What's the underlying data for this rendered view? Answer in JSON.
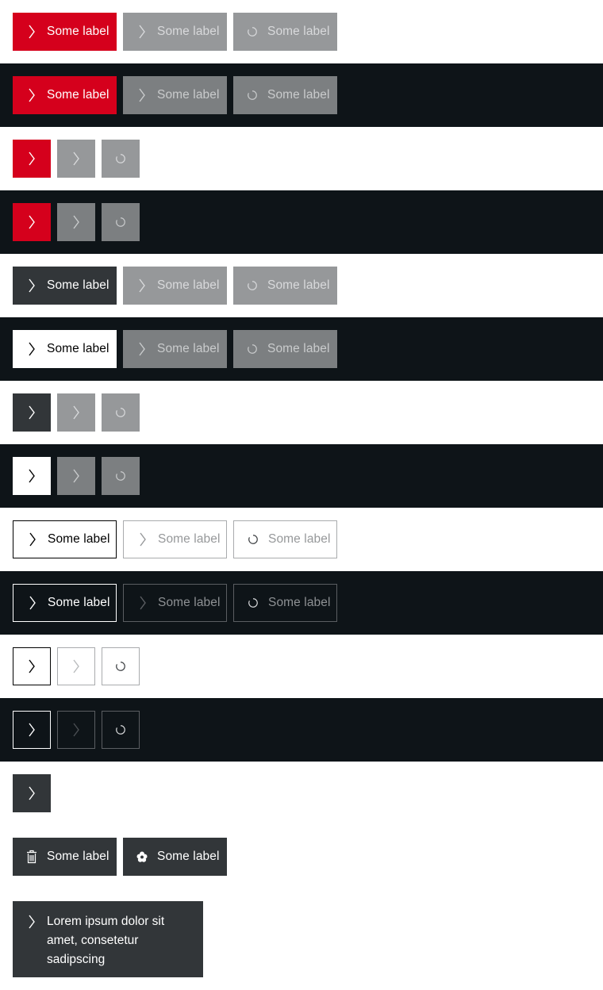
{
  "button_label": "Some label",
  "multiline_label": "Lorem ipsum dolor sit amet, consetetur sadipscing",
  "icons": {
    "arrow": "arrow-right-icon",
    "loading": "spinner-icon",
    "delete": "trash-icon",
    "custom": "flower-icon"
  },
  "colors": {
    "brand_red": "#d5001c",
    "dark_theme_background": "#0e1418",
    "dark_button": "#323639",
    "disabled_light": "#96989a",
    "disabled_dark": "#7c7f81"
  }
}
